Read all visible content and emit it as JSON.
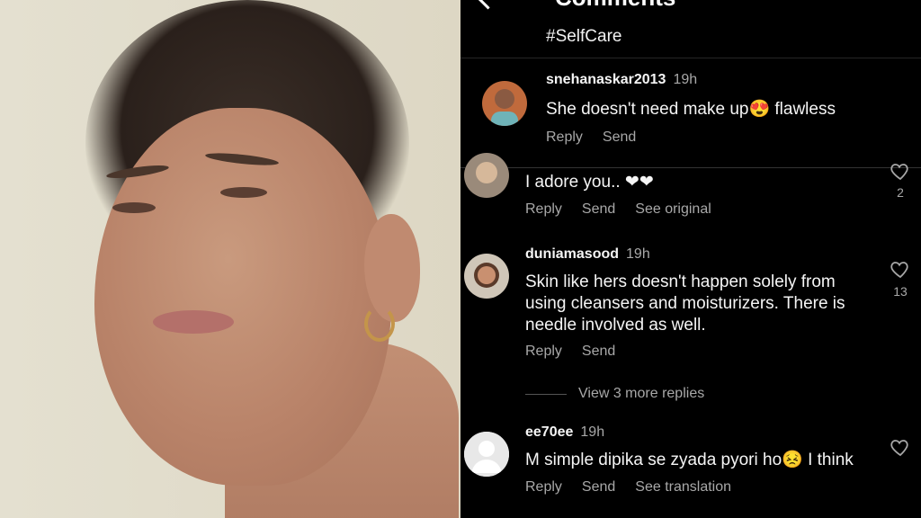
{
  "header": {
    "title": "Comments",
    "hashtag": "#SelfCare"
  },
  "comments": [
    {
      "username": "snehanaskar2013",
      "time": "19h",
      "text": "She doesn't need make up😍 flawless",
      "actions": [
        "Reply",
        "Send"
      ]
    },
    {
      "username": "",
      "time": "",
      "text": "I adore you.. ❤❤",
      "actions": [
        "Reply",
        "Send",
        "See original"
      ],
      "likes": "2"
    },
    {
      "username": "duniamasood",
      "time": "19h",
      "text": "Skin like hers doesn't happen solely from using cleansers and moisturizers. There is needle involved as well.",
      "actions": [
        "Reply",
        "Send"
      ],
      "likes": "13",
      "view_replies": "View 3 more replies"
    },
    {
      "username": "ee70ee",
      "time": "19h",
      "text": "M simple dipika se zyada pyori ho😣 I think",
      "actions": [
        "Reply",
        "Send",
        "See translation"
      ]
    }
  ],
  "icons": {
    "back": "back-arrow-icon",
    "like": "heart-outline-icon"
  },
  "colors": {
    "background": "#000000",
    "text": "#f5f5f5",
    "secondary_text": "#a8a8a8"
  }
}
